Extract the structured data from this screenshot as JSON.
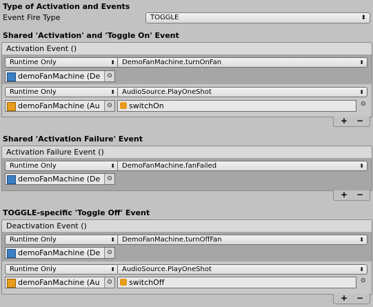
{
  "header": {
    "title": "Type of Activation and Events",
    "fire_type_label": "Event Fire Type",
    "fire_type_value": "TOGGLE"
  },
  "sections": [
    {
      "title": "Shared 'Activation' and 'Toggle On' Event",
      "panel_label": "Activation Event ()",
      "rows": [
        {
          "mode": "Runtime Only",
          "method": "DemoFanMachine.turnOnFan",
          "object": "demoFanMachine (De"
        },
        {
          "mode": "Runtime Only",
          "method": "AudioSource.PlayOneShot",
          "object": "demoFanMachine (Au",
          "argument": "switchOn"
        }
      ]
    },
    {
      "title": "Shared 'Activation Failure' Event",
      "panel_label": "Activation Failure Event ()",
      "rows": [
        {
          "mode": "Runtime Only",
          "method": "DemoFanMachine.fanFailed",
          "object": "demoFanMachine (De"
        }
      ]
    },
    {
      "title": "TOGGLE-specific 'Toggle Off' Event",
      "panel_label": "Deactivation Event ()",
      "rows": [
        {
          "mode": "Runtime Only",
          "method": "DemoFanMachine.turnOffFan",
          "object": "demoFanMachine (De"
        },
        {
          "mode": "Runtime Only",
          "method": "AudioSource.PlayOneShot",
          "object": "demoFanMachine (Au",
          "argument": "switchOff"
        }
      ]
    }
  ],
  "buttons": {
    "add": "+",
    "remove": "−"
  },
  "glyphs": {
    "dropdown_arrow": "⬍",
    "picker": "⊙"
  },
  "colors": {
    "background": "#c2c2c2",
    "row_dark": "#a6a6a6",
    "script_icon": "#3b7fc4",
    "audio_icon": "#e89b1c"
  }
}
